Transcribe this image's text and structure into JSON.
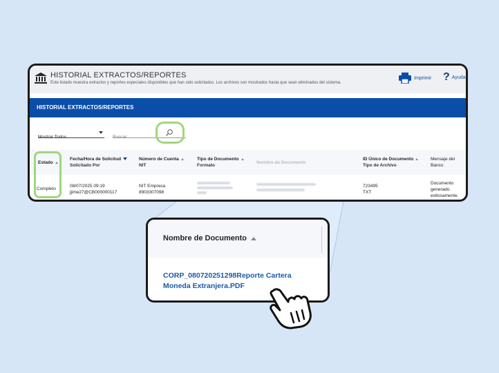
{
  "header": {
    "title": "HISTORIAL EXTRACTOS/REPORTES",
    "subtitle": "Este listado muestra extractos y reportes especiales disponibles que han sido solicitados. Los archivos son mostrados hasta que sean eliminados del sistema.",
    "print_label": "Imprimir",
    "help_label": "Ayuda"
  },
  "section": {
    "title": "HISTORIAL EXTRACTOS/REPORTES"
  },
  "filters": {
    "show_select": "Mostrar Todos",
    "search_placeholder": "Buscar"
  },
  "table": {
    "columns": [
      {
        "main": "Estado",
        "sub": ""
      },
      {
        "main": "Fecha/Hora de Solicitud",
        "sub": "Solicitado Por"
      },
      {
        "main": "Número de Cuenta",
        "sub": "NIT"
      },
      {
        "main": "Tipo de Documento",
        "sub": "Formato"
      },
      {
        "main": "Nombre de Documento",
        "sub": ""
      },
      {
        "main": "ID Único de Documento",
        "sub": "Tipo de Archivo"
      },
      {
        "main": "Mensaje del",
        "sub": "Banco"
      }
    ],
    "row": {
      "estado": "Completo",
      "fecha": "08/07/2025 09:19",
      "solicitado": "jjime27@CB000000117",
      "cuenta": "NIT Empresa",
      "nit": "8903307098",
      "id_unico": "723495",
      "tipo_archivo": "TXT",
      "mensaje_1": "Documento",
      "mensaje_2": "generado",
      "mensaje_3": "exitosamente."
    }
  },
  "zoom": {
    "column_label": "Nombre de Documento",
    "document_link": "CORP_080720251298Reporte Cartera Moneda Extranjera.PDF"
  },
  "colors": {
    "accent_blue": "#0a4eaa",
    "highlight_green": "#9fd67f",
    "link_blue": "#1a5aa6",
    "background": "#d7e6f7"
  }
}
